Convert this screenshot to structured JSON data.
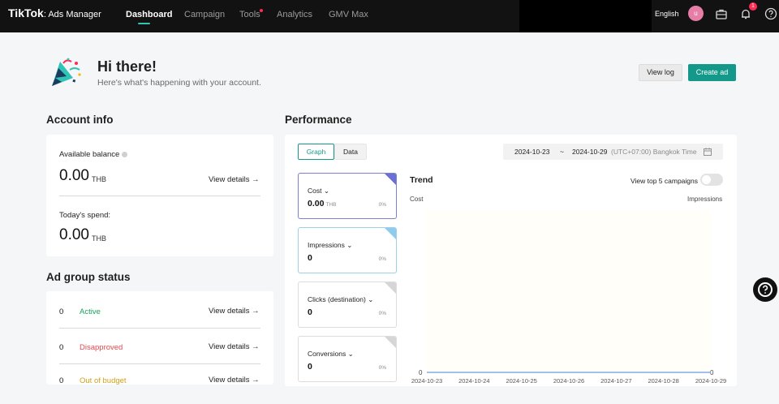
{
  "header": {
    "logo": "TikTok",
    "logo_sub": ": Ads Manager",
    "nav": [
      {
        "label": "Dashboard"
      },
      {
        "label": "Campaign"
      },
      {
        "label": "Tools"
      },
      {
        "label": "Analytics"
      },
      {
        "label": "GMV Max"
      }
    ],
    "language": "English",
    "avatar_letter": "u",
    "notification_count": "1"
  },
  "greeting": {
    "title": "Hi there!",
    "subtitle": "Here's what's happening with your account.",
    "view_log": "View log",
    "create_ad": "Create ad"
  },
  "account_info": {
    "title": "Account info",
    "available_balance_label": "Available balance",
    "available_balance_value": "0.00",
    "available_balance_currency": "THB",
    "view_details": "View details →",
    "todays_spend_label": "Today's spend:",
    "todays_spend_value": "0.00",
    "todays_spend_currency": "THB"
  },
  "ad_group_status": {
    "title": "Ad group status",
    "rows": [
      {
        "count": "0",
        "label": "Active",
        "color": "#1aa260",
        "link": "View details →"
      },
      {
        "count": "0",
        "label": "Disapproved",
        "color": "#e5484d",
        "link": "View details →"
      },
      {
        "count": "0",
        "label": "Out of budget",
        "color": "#d4a017",
        "link": "View details →"
      }
    ]
  },
  "performance": {
    "title": "Performance",
    "tabs": [
      {
        "label": "Graph"
      },
      {
        "label": "Data"
      }
    ],
    "date_start": "2024-10-23",
    "date_sep": "~",
    "date_end": "2024-10-29",
    "timezone": "(UTC+07:00) Bangkok Time",
    "metrics": [
      {
        "name": "Cost",
        "value": "0.00",
        "unit": "THB",
        "change": "0%",
        "corner_color": "#6a6fd1"
      },
      {
        "name": "Impressions",
        "value": "0",
        "unit": "",
        "change": "0%",
        "corner_color": "#8fcbea"
      },
      {
        "name": "Clicks (destination)",
        "value": "0",
        "unit": "",
        "change": "0%",
        "corner_color": "#d6d6d6"
      },
      {
        "name": "Conversions",
        "value": "0",
        "unit": "",
        "change": "0%",
        "corner_color": "#d6d6d6"
      }
    ],
    "trend_title": "Trend",
    "toggle_label": "View top 5 campaigns",
    "left_axis_label": "Cost",
    "right_axis_label": "Impressions"
  },
  "chart_data": {
    "type": "line",
    "x": [
      "2024-10-23",
      "2024-10-24",
      "2024-10-25",
      "2024-10-26",
      "2024-10-27",
      "2024-10-28",
      "2024-10-29"
    ],
    "series": [
      {
        "name": "Cost",
        "values": [
          0,
          0,
          0,
          0,
          0,
          0,
          0
        ],
        "color": "#6a6fd1"
      },
      {
        "name": "Impressions",
        "values": [
          0,
          0,
          0,
          0,
          0,
          0,
          0
        ],
        "color": "#8fcbea"
      }
    ],
    "ylabel": "Cost",
    "y2label": "Impressions",
    "y_ticks": [
      "0"
    ],
    "y2_ticks": [
      "0"
    ]
  },
  "colors": {
    "accent": "#13988a",
    "topbar": "#121212",
    "nav_active_underline": "#2ec4b6",
    "notification": "#fe2c55"
  },
  "icons": {
    "tools_badge": "red-dot",
    "greeting": "party-popper-icon",
    "balance_info": "info-icon",
    "briefcase": "briefcase-icon",
    "bell": "bell-icon",
    "help": "help-circle-icon",
    "calendar": "calendar-icon",
    "chevron": "chevron-down-icon"
  }
}
